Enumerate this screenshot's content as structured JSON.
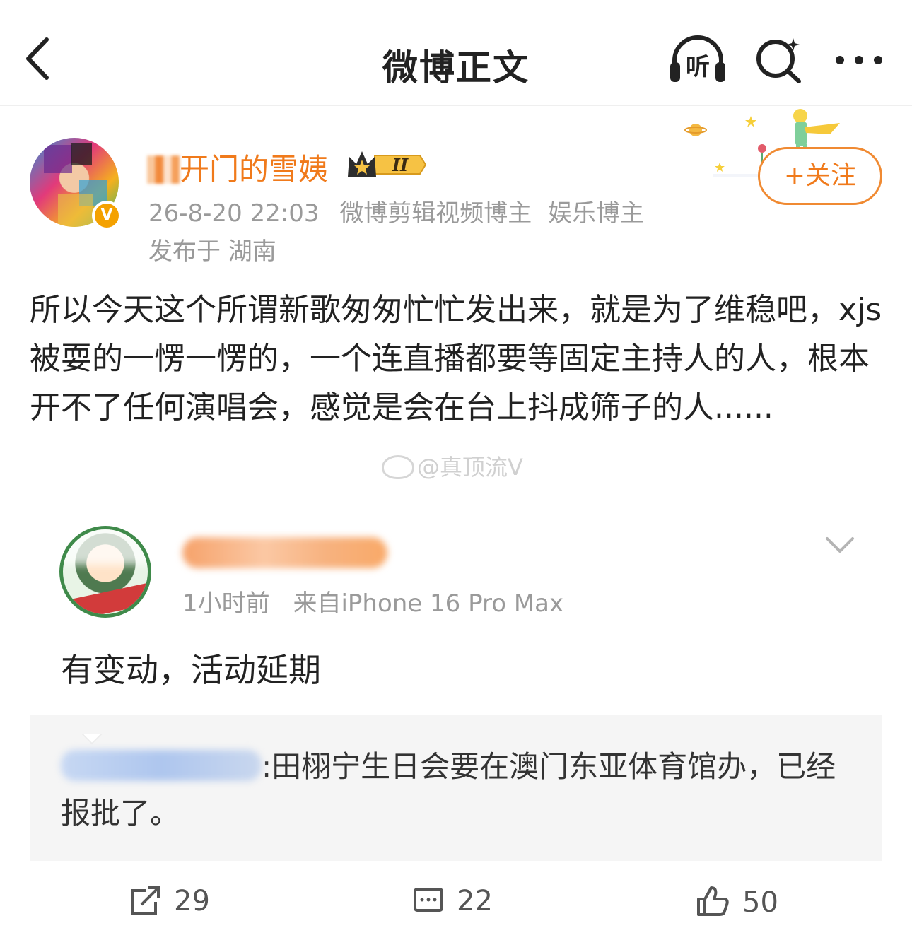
{
  "header": {
    "title": "微博正文",
    "listen_label": "听",
    "icons": [
      "back-arrow-icon",
      "listen-headphones-icon",
      "search-sparkle-icon",
      "more-dots-icon"
    ]
  },
  "post": {
    "username": "开门的雪姨",
    "badge_level": "II",
    "timestamp": "26-8-20 22:03",
    "source_tags": [
      "微博剪辑视频博主",
      "娱乐博主"
    ],
    "location": "发布于 湖南",
    "follow_label": "+关注",
    "verified_mark": "V",
    "text": "所以今天这个所谓新歌匆匆忙忙发出来，就是为了维稳吧，xjs被耍的一愣一愣的，一个连直播都要等固定主持人的人，根本开不了任何演唱会，感觉是会在台上抖成筛子的人......",
    "watermark": "@真顶流V"
  },
  "comment": {
    "time": "1小时前",
    "source": "来自iPhone 16 Pro Max",
    "text": "有变动，活动延期",
    "quote_text": ":田栩宁生日会要在澳门东亚体育馆办，已经报批了。"
  },
  "actions": {
    "repost_count": "29",
    "comment_count": "22",
    "like_count": "50"
  },
  "colors": {
    "accent_orange": "#f07a1b",
    "meta_gray": "#9a9a9a",
    "quote_bg": "#f5f5f5"
  }
}
